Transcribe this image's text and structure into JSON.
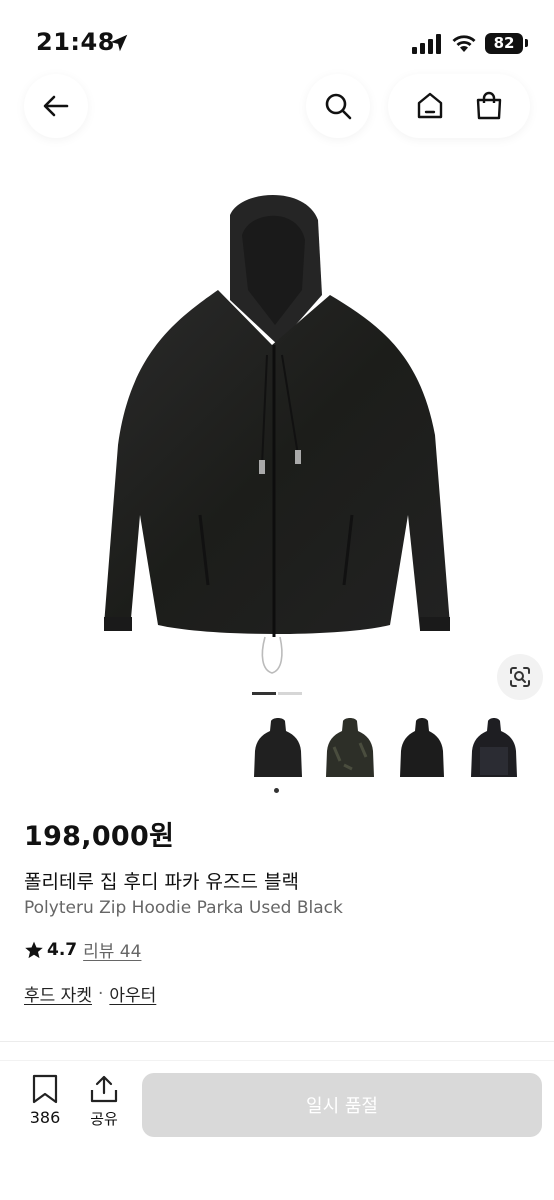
{
  "status_bar": {
    "time": "21:48",
    "battery": "82"
  },
  "product": {
    "price": "198,000원",
    "name_ko": "폴리테루 집 후디 파카 유즈드 블랙",
    "name_en": "Polyteru Zip Hoodie Parka Used Black",
    "rating": "4.7",
    "review_label": "리뷰 44",
    "categories": [
      "후드 자켓",
      "아우터"
    ],
    "category_separator": "·"
  },
  "carousel": {
    "current_page": 1,
    "total_pages": 2
  },
  "bottom_bar": {
    "bookmark_count": "386",
    "share_label": "공유",
    "buy_button_label": "일시 품절"
  },
  "colors": {
    "text": "#111111",
    "muted": "#666666",
    "button_disabled": "#d9d9d9"
  },
  "icons": [
    "arrow-left-icon",
    "search-icon",
    "home-icon",
    "shopping-bag-icon",
    "lens-search-icon",
    "star-icon",
    "bookmark-icon",
    "share-icon"
  ]
}
